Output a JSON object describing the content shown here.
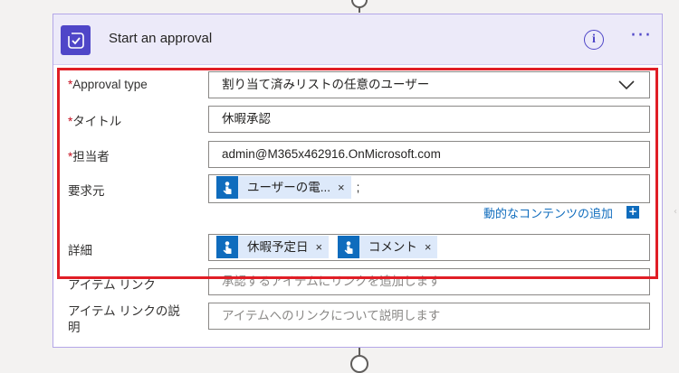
{
  "header": {
    "title": "Start an approval",
    "icon": "approval-check-icon",
    "info_icon": "i",
    "more_icon": "···",
    "accent_color": "#4f46c8",
    "header_bg": "#eceaf9"
  },
  "fields": {
    "approval_type": {
      "label": "Approval type",
      "required_mark": "*",
      "value": "割り当て済みリストの任意のユーザー"
    },
    "title": {
      "label": "タイトル",
      "required_mark": "*",
      "value": "休暇承認"
    },
    "assigned_to": {
      "label": "担当者",
      "required_mark": "*",
      "value": "admin@M365x462916.OnMicrosoft.com"
    },
    "requestor": {
      "label": "要求元",
      "tokens": [
        {
          "text": "ユーザーの電...",
          "remove": "×",
          "icon": "user-touch-icon"
        }
      ],
      "separator": ";"
    },
    "details": {
      "label": "詳細",
      "tokens": [
        {
          "text": "休暇予定日",
          "remove": "×",
          "icon": "user-touch-icon"
        },
        {
          "text": "コメント",
          "remove": "×",
          "icon": "user-touch-icon"
        }
      ]
    },
    "item_link": {
      "label": "アイテム リンク",
      "placeholder": "承認するアイテムにリンクを追加します"
    },
    "item_link_description": {
      "label_line1": "アイテム リンクの説",
      "label_line2": "明",
      "placeholder": "アイテムへのリンクについて説明します"
    }
  },
  "dynamic_content": {
    "label": "動的なコンテンツの追加",
    "icon": "add-dynamic-content-icon"
  },
  "highlight_color": "#e01e26",
  "token_color": "#0f6cbd"
}
